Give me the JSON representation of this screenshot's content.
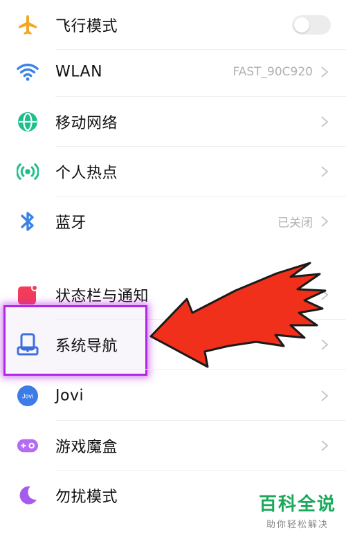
{
  "settings": {
    "items": [
      {
        "label": "飞行模式",
        "value": "",
        "icon": "airplane-icon"
      },
      {
        "label": "WLAN",
        "value": "FAST_90C920",
        "icon": "wifi-icon"
      },
      {
        "label": "移动网络",
        "value": "",
        "icon": "globe-icon"
      },
      {
        "label": "个人热点",
        "value": "",
        "icon": "hotspot-icon"
      },
      {
        "label": "蓝牙",
        "value": "已关闭",
        "icon": "bluetooth-icon"
      },
      {
        "label": "状态栏与通知",
        "value": "",
        "icon": "notification-icon"
      },
      {
        "label": "系统导航",
        "value": "",
        "icon": "navigation-icon"
      },
      {
        "label": "Jovi",
        "value": "",
        "icon": "jovi-icon",
        "icon_text": "Jovi"
      },
      {
        "label": "游戏魔盒",
        "value": "",
        "icon": "game-box-icon"
      },
      {
        "label": "勿扰模式",
        "value": "",
        "icon": "moon-icon"
      }
    ]
  },
  "watermark": {
    "title": "百科全说",
    "subtitle": "助你轻松解决"
  },
  "colors": {
    "airplane": "#f5a623",
    "wifi": "#3b82e8",
    "globe": "#1cc08c",
    "hotspot": "#1cc08c",
    "bluetooth": "#3b82e8",
    "notification": "#f23c5a",
    "navigation": "#3b6fe0",
    "jovi": "#3d7be6",
    "game": "#b56cf2",
    "moon": "#a45cf0",
    "highlight": "#b227e6",
    "arrow": "#f0301a"
  }
}
